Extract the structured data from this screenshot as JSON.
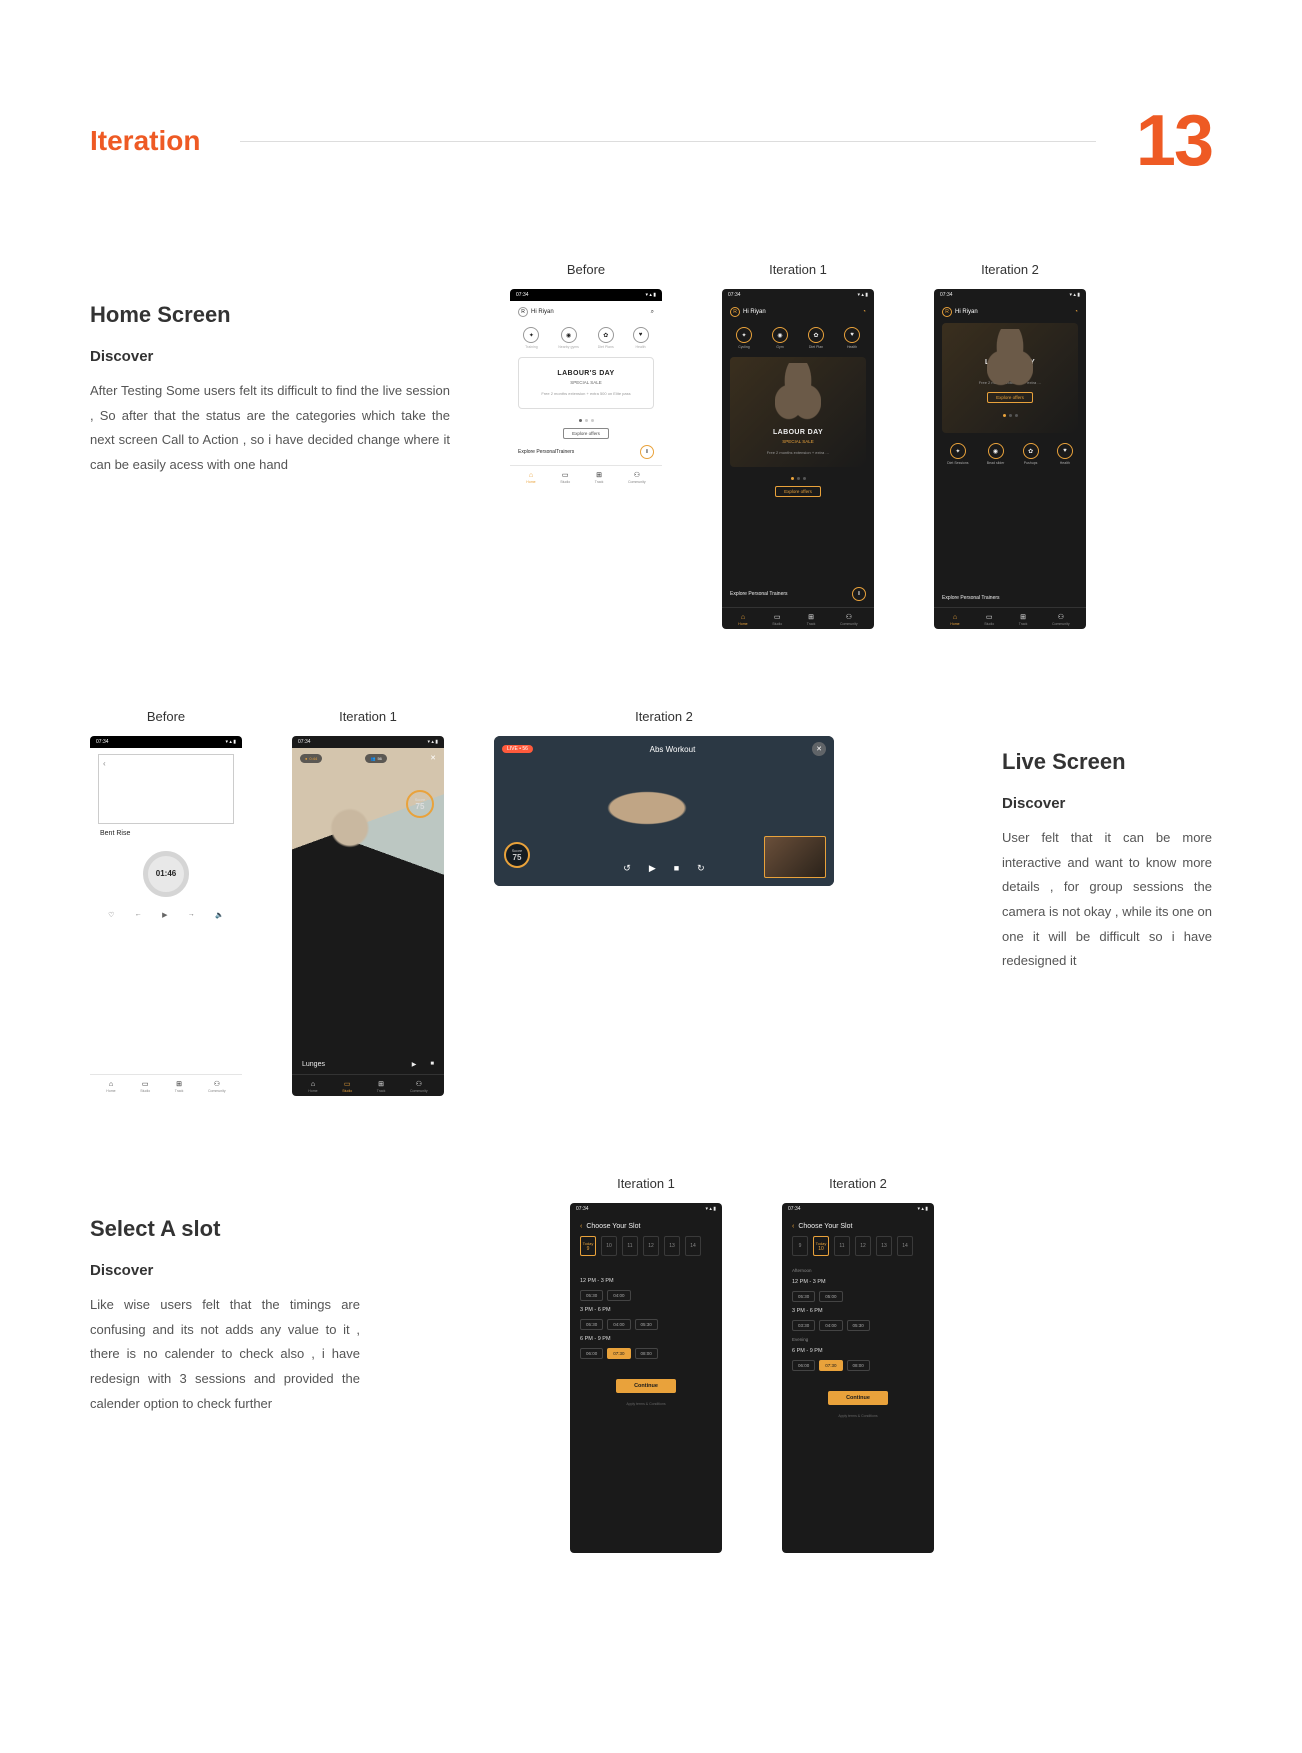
{
  "page": {
    "title": "Iteration",
    "number": "13"
  },
  "labels": {
    "before": "Before",
    "iter1": "Iteration 1",
    "iter2": "Iteration 2"
  },
  "home": {
    "heading": "Home Screen",
    "sub": "Discover",
    "body": "After Testing Some users felt  its difficult to find the live session , So after that the status are the categories which take  the next screen Call to Action , so i have decided change where it can be easily acess with one hand",
    "time": "07:34",
    "greeting": "Hi Riyan",
    "avatar_letter": "R",
    "cats_light": [
      "Training",
      "Nearby gyms",
      "Diet Plans",
      "Health"
    ],
    "cats_d1": [
      "Cycling",
      "Gym",
      "Diet Plan",
      "Health"
    ],
    "cats_d2": [
      "Diet Sessions",
      "Bead slider",
      "Pushups",
      "Health"
    ],
    "promo_light": {
      "title": "LABOUR'S DAY",
      "sub": "SPECIAL SALE",
      "extra": "Free 2 months extension + extra 500 on Elite pass"
    },
    "promo_dark": {
      "title": "LABOUR DAY",
      "sub": "SPECIAL SALE",
      "extra": "Free 2 months extension + extra …"
    },
    "explore_btn": "Explore offers",
    "explore_trainers": "Explore PersonalTrainers",
    "explore_trainers_sp": "Explore Personal Trainers",
    "nav": [
      "Home",
      "Studio",
      "Track",
      "Community"
    ]
  },
  "live": {
    "heading": "Live Screen",
    "sub": "Discover",
    "body": "User felt that it can be more interactive and want to know more details , for group sessions the camera is not okay , while its one on one it will be difficult so i have redesigned it",
    "before": {
      "exercise": "Bent Rise",
      "timer": "01:46"
    },
    "iter1": {
      "top_left": "0:44",
      "top_pill": "56",
      "score_lbl": "Score",
      "score_val": "75",
      "exercise": "Lunges"
    },
    "iter2": {
      "live_tag": "LIVE • 56",
      "title": "Abs Workout",
      "score_lbl": "Score",
      "score_val": "75"
    }
  },
  "slot": {
    "heading": "Select A slot",
    "sub": "Discover",
    "body": "Like wise users felt   that the timings are confusing and its not adds any value to it , there is no calender to check also , i have redesign with 3 sessions and provided the calender option to check further",
    "time": "07:34",
    "title": "Choose  Your Slot",
    "dates1": [
      {
        "d": "Today",
        "n": "9"
      },
      {
        "d": "",
        "n": "10"
      },
      {
        "d": "",
        "n": "11"
      },
      {
        "d": "",
        "n": "12"
      },
      {
        "d": "",
        "n": "13"
      },
      {
        "d": "",
        "n": "14"
      }
    ],
    "dates2": [
      {
        "d": "",
        "n": "9"
      },
      {
        "d": "Today",
        "n": "10"
      },
      {
        "d": "",
        "n": "11"
      },
      {
        "d": "",
        "n": "12"
      },
      {
        "d": "",
        "n": "13"
      },
      {
        "d": "",
        "n": "14"
      }
    ],
    "i1": {
      "g1": {
        "hdr": "12 PM - 3 PM",
        "chips": [
          "05:30",
          "04:00"
        ]
      },
      "g2": {
        "hdr": "3 PM - 6 PM",
        "chips": [
          "05:30",
          "04:00",
          "05:30"
        ]
      },
      "g3": {
        "hdr": "6 PM - 9 PM",
        "chips": [
          "06:00",
          "07:30",
          "08:00"
        ]
      }
    },
    "i2": {
      "aft_lbl": "Afternoon",
      "g1": {
        "hdr": "12 PM - 3 PM",
        "chips": [
          "05:30",
          "05:00"
        ]
      },
      "g2": {
        "hdr": "3 PM - 6 PM",
        "chips": [
          "03:30",
          "04:00",
          "05:30"
        ]
      },
      "eve_lbl": "Evening",
      "g3": {
        "hdr": "6 PM - 9 PM",
        "chips": [
          "06:00",
          "07:30",
          "08:00"
        ]
      }
    },
    "continue": "Continue",
    "tos": "Apply terms & Conditions"
  }
}
